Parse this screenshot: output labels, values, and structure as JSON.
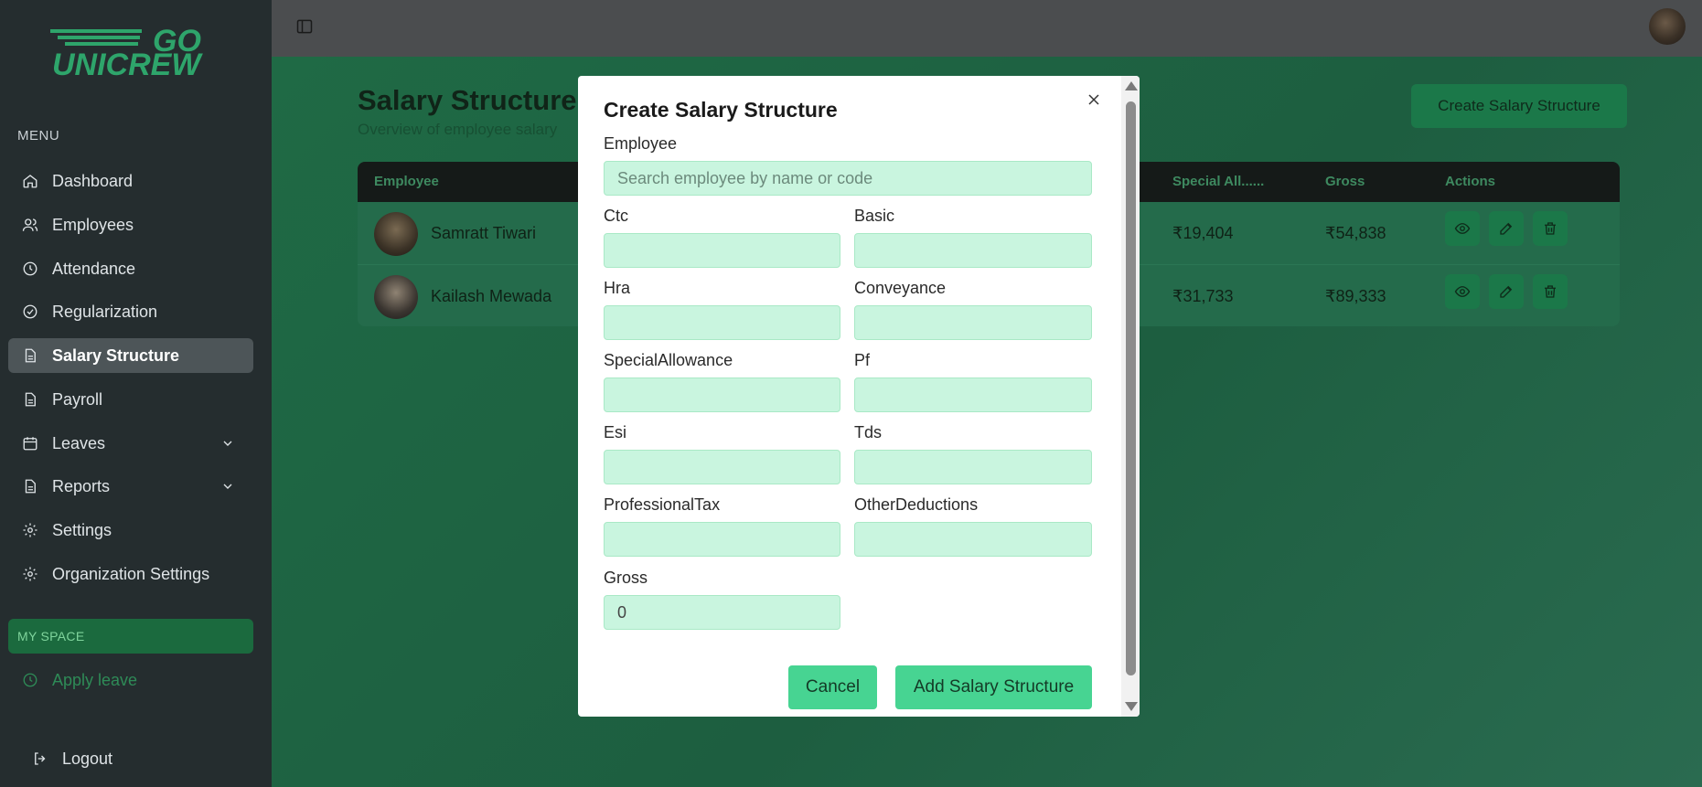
{
  "sidebar": {
    "logo_top": "GO",
    "logo_bottom": "UNICREW",
    "menu_heading": "MENU",
    "items": [
      {
        "label": "Dashboard",
        "icon": "home-icon"
      },
      {
        "label": "Employees",
        "icon": "users-icon"
      },
      {
        "label": "Attendance",
        "icon": "clock-icon"
      },
      {
        "label": "Regularization",
        "icon": "check-circle-icon"
      },
      {
        "label": "Salary Structure",
        "icon": "document-icon",
        "active": true
      },
      {
        "label": "Payroll",
        "icon": "document-icon"
      },
      {
        "label": "Leaves",
        "icon": "calendar-icon",
        "expandable": true
      },
      {
        "label": "Reports",
        "icon": "document-icon",
        "expandable": true
      },
      {
        "label": "Settings",
        "icon": "gear-icon"
      },
      {
        "label": "Organization Settings",
        "icon": "gear-icon"
      }
    ],
    "my_space_heading": "MY SPACE",
    "apply_leave": "Apply leave",
    "logout": "Logout"
  },
  "header": {
    "title": "Salary Structure",
    "subtitle": "Overview of employee salary",
    "create_button": "Create Salary Structure"
  },
  "table": {
    "columns": [
      "Employee",
      "Special All......",
      "Gross",
      "Actions"
    ],
    "rows": [
      {
        "name": "Samratt Tiwari",
        "special_allowance": "₹19,404",
        "gross": "₹54,838"
      },
      {
        "name": "Kailash Mewada",
        "special_allowance": "₹31,733",
        "gross": "₹89,333"
      }
    ]
  },
  "modal": {
    "title": "Create Salary Structure",
    "employee_label": "Employee",
    "employee_placeholder": "Search employee by name or code",
    "fields": {
      "ctc": "Ctc",
      "basic": "Basic",
      "hra": "Hra",
      "conveyance": "Conveyance",
      "special_allowance": "SpecialAllowance",
      "pf": "Pf",
      "esi": "Esi",
      "tds": "Tds",
      "professional_tax": "ProfessionalTax",
      "other_deductions": "OtherDeductions",
      "gross": "Gross"
    },
    "gross_value": "0",
    "cancel_button": "Cancel",
    "add_button": "Add Salary Structure"
  },
  "colors": {
    "sidebar_bg": "#252d2f",
    "accent": "#47d492",
    "input_bg": "#c9f5df"
  }
}
